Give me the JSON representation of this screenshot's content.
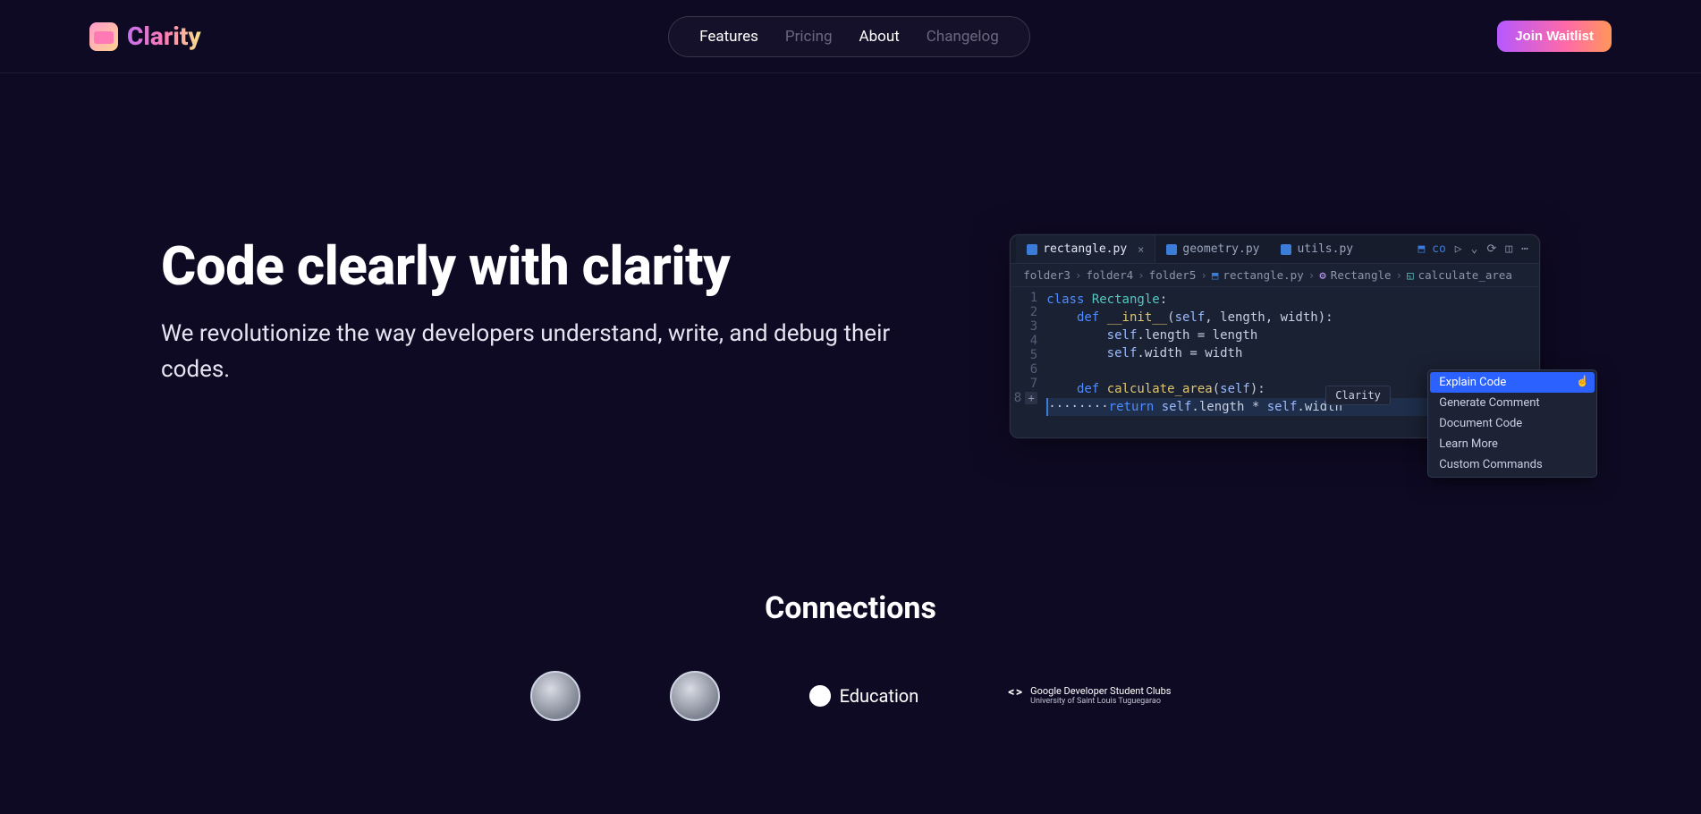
{
  "brand": "Clarity",
  "nav": {
    "items": [
      {
        "label": "Features",
        "dim": false
      },
      {
        "label": "Pricing",
        "dim": true
      },
      {
        "label": "About",
        "dim": false
      },
      {
        "label": "Changelog",
        "dim": true
      }
    ]
  },
  "cta_label": "Join Waitlist",
  "hero": {
    "title": "Code clearly with clarity",
    "subtitle": "We revolutionize the way developers understand, write, and debug their codes."
  },
  "editor": {
    "tabs": [
      {
        "label": "rectangle.py",
        "active": true,
        "closable": true
      },
      {
        "label": "geometry.py",
        "active": false,
        "closable": false
      },
      {
        "label": "utils.py",
        "active": false,
        "closable": false
      }
    ],
    "tab_actions_text": "co",
    "breadcrumbs": {
      "segments": [
        "folder3",
        "folder4",
        "folder5"
      ],
      "file": "rectangle.py",
      "class": "Rectangle",
      "func": "calculate_area"
    },
    "line_numbers": [
      "1",
      "2",
      "3",
      "4",
      "5",
      "6",
      "7",
      "8"
    ],
    "tooltip": "Clarity",
    "context_menu": [
      {
        "label": "Explain Code",
        "selected": true
      },
      {
        "label": "Generate Comment",
        "selected": false
      },
      {
        "label": "Document Code",
        "selected": false
      },
      {
        "label": "Learn More",
        "selected": false
      },
      {
        "label": "Custom Commands",
        "selected": false
      }
    ]
  },
  "connections": {
    "heading": "Connections",
    "github_edu": "Education",
    "gdsc_title": "Google Developer Student Clubs",
    "gdsc_sub": "University of Saint Louis Tuguegarao"
  }
}
